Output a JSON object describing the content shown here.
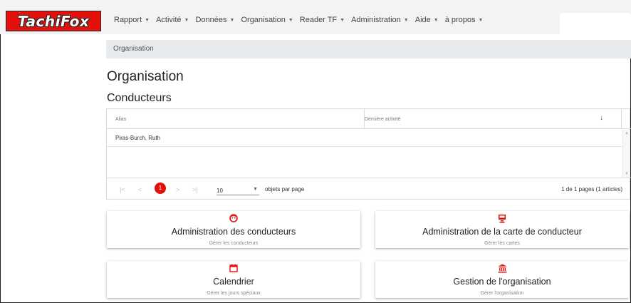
{
  "brand": {
    "logo_text": "TachiFox",
    "accent": "#e4100c"
  },
  "menu": [
    {
      "label": "Rapport"
    },
    {
      "label": "Activité"
    },
    {
      "label": "Données"
    },
    {
      "label": "Organisation"
    },
    {
      "label": "Reader TF"
    },
    {
      "label": "Administration"
    },
    {
      "label": "Aide"
    },
    {
      "label": "à propos"
    }
  ],
  "breadcrumb": "Organisation",
  "page_title": "Organisation",
  "section_title": "Conducteurs",
  "table": {
    "columns": [
      "Alias",
      "Dernière activité"
    ],
    "sort_indicator": "↓",
    "rows": [
      {
        "alias": "Piras-Burch, Ruth",
        "last_activity": ""
      }
    ],
    "pager": {
      "first": "|<",
      "prev": "<",
      "current_page": "1",
      "next": ">",
      "last": ">|",
      "per_page": "10",
      "per_page_label": "objets par page",
      "page_info": "1 de 1 pages (1 articles)"
    }
  },
  "cards": [
    {
      "icon": "driver-face-icon",
      "title": "Administration des conducteurs",
      "subtitle": "Gérer les conducteurs"
    },
    {
      "icon": "card-reader-icon",
      "title": "Administration de la carte de conducteur",
      "subtitle": "Gérer les cartes"
    },
    {
      "icon": "calendar-icon",
      "title": "Calendrier",
      "subtitle": "Gérer les jours spéciaux"
    },
    {
      "icon": "bank-building-icon",
      "title": "Gestion de l'organisation",
      "subtitle": "Gérer l'organisation"
    }
  ]
}
